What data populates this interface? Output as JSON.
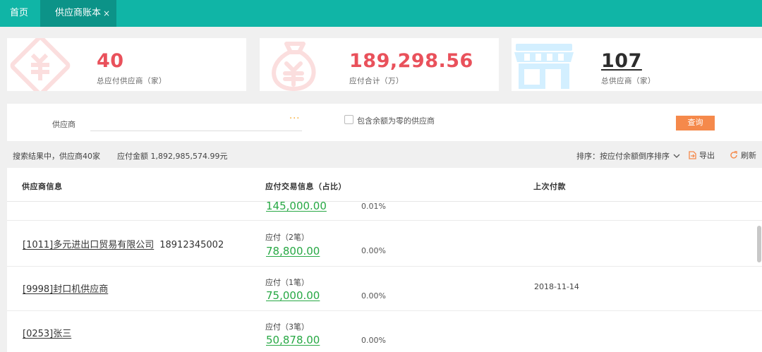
{
  "tabs": {
    "home": "首页",
    "active": "供应商账本",
    "close": "×"
  },
  "stats": [
    {
      "value": "40",
      "label": "总应付供应商（家）",
      "icon": "payable-vendor-icon"
    },
    {
      "value": "189,298.56",
      "label": "应付合计（万）",
      "icon": "money-bag-icon"
    },
    {
      "value": "107",
      "label": "总供应商（家）",
      "icon": "store-icon"
    }
  ],
  "filter": {
    "supplier_label": "供应商",
    "supplier_value": "",
    "dots": "···",
    "include_zero_label": "包含余额为零的供应商",
    "include_zero_checked": false,
    "query_button": "查询"
  },
  "summary": {
    "result": "搜索结果中，供应商40家",
    "amount": "应付金额 1,892,985,574.99元",
    "sort": "排序：按应付余额倒序排序",
    "export": "导出",
    "refresh": "刷新"
  },
  "table": {
    "headers": [
      "供应商信息",
      "应付交易信息（占比）",
      "上次付款"
    ],
    "rows": [
      {
        "supplier": "",
        "phone": "",
        "pay_label": "",
        "amount": "145,000.00",
        "ratio": "0.01%",
        "last_payment": ""
      },
      {
        "supplier": "[1011]多元进出口贸易有限公司",
        "phone": "18912345002",
        "pay_label": "应付（2笔）",
        "amount": "78,800.00",
        "ratio": "0.00%",
        "last_payment": ""
      },
      {
        "supplier": "[9998]封口机供应商",
        "phone": "",
        "pay_label": "应付（1笔）",
        "amount": "75,000.00",
        "ratio": "0.00%",
        "last_payment": "2018-11-14"
      },
      {
        "supplier": "[0253]张三",
        "phone": "",
        "pay_label": "应付（3笔）",
        "amount": "50,878.00",
        "ratio": "0.00%",
        "last_payment": ""
      }
    ]
  },
  "colors": {
    "topbar": "#10b5a6",
    "active_tab": "#0c9388",
    "stat_red": "#e9515b",
    "amount_green": "#27a844",
    "query_orange": "#f5894b"
  }
}
